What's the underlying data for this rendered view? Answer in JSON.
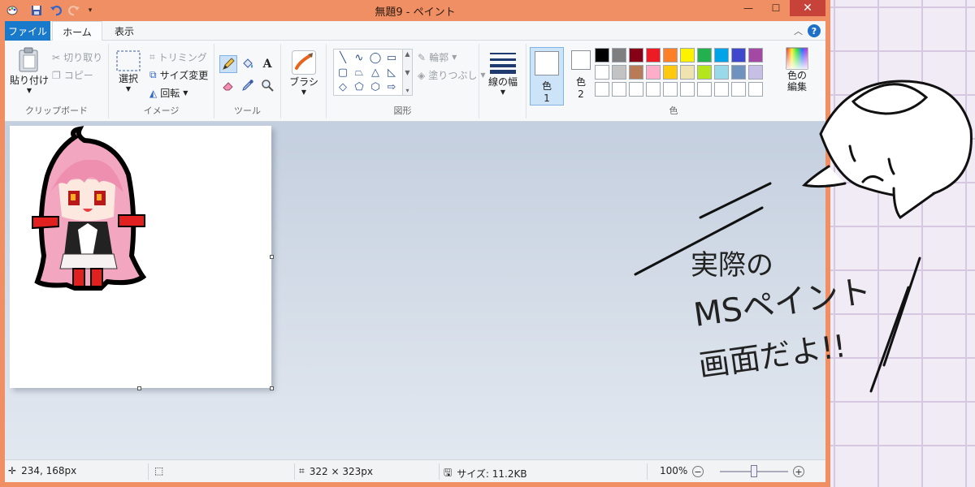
{
  "window": {
    "title": "無題9 - ペイント",
    "minimize_glyph": "—",
    "maximize_glyph": "☐",
    "close_glyph": "✕"
  },
  "tabs": {
    "file": "ファイル",
    "home": "ホーム",
    "view": "表示"
  },
  "ribbon": {
    "clipboard": {
      "paste": "貼り付け",
      "cut": "切り取り",
      "copy": "コピー",
      "label": "クリップボード"
    },
    "image": {
      "select": "選択",
      "crop": "トリミング",
      "resize": "サイズ変更",
      "rotate": "回転",
      "label": "イメージ"
    },
    "tools": {
      "label": "ツール"
    },
    "brushes": {
      "label": "ブラシ"
    },
    "shapes": {
      "outline": "輪郭",
      "fill": "塗りつぶし",
      "label": "図形"
    },
    "size": {
      "label": "線の幅"
    },
    "colors": {
      "color1": "色",
      "color1_num": "1",
      "color2": "色",
      "color2_num": "2",
      "edit": "色の\n編集",
      "label": "色",
      "primary": "#ffffff",
      "secondary": "#ffffff",
      "palette": [
        "#000000",
        "#7f7f7f",
        "#880015",
        "#ed1c24",
        "#ff7f27",
        "#fff200",
        "#22b14c",
        "#00a2e8",
        "#3f48cc",
        "#a349a4",
        "#ffffff",
        "#c3c3c3",
        "#b97a57",
        "#ffaec9",
        "#ffc90e",
        "#efe4b0",
        "#b5e61d",
        "#99d9ea",
        "#7092be",
        "#c8bfe7",
        "#ffffff",
        "#ffffff",
        "#ffffff",
        "#ffffff",
        "#ffffff",
        "#ffffff",
        "#ffffff",
        "#ffffff",
        "#ffffff",
        "#ffffff"
      ]
    }
  },
  "status": {
    "cursor": "234, 168px",
    "canvas_size": "322 × 323px",
    "file_size": "サイズ: 11.2KB",
    "zoom": "100%",
    "zoom_level_fraction": 0.5
  },
  "annotation": {
    "line1": "実際の",
    "line2": "MSペイント",
    "line3": "画面だよ!!"
  }
}
